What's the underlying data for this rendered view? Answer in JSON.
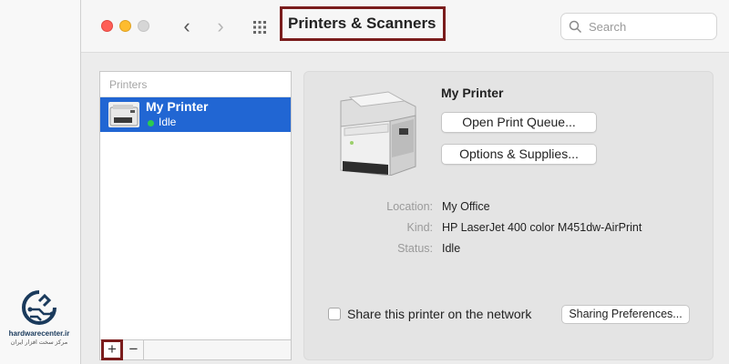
{
  "window": {
    "title": "Printers & Scanners",
    "nav_back_glyph": "‹",
    "nav_forward_glyph": "›"
  },
  "search": {
    "placeholder": "Search",
    "value": ""
  },
  "printers_list": {
    "header": "Printers",
    "items": [
      {
        "name": "My Printer",
        "status": "Idle",
        "status_color": "#2ccc4f",
        "selected": true
      }
    ],
    "add_label": "+",
    "remove_label": "−"
  },
  "detail": {
    "name": "My Printer",
    "open_queue_label": "Open Print Queue...",
    "options_label": "Options & Supplies...",
    "location_label": "Location:",
    "location_value": "My Office",
    "kind_label": "Kind:",
    "kind_value": "HP LaserJet 400 color M451dw-AirPrint",
    "status_label": "Status:",
    "status_value": "Idle",
    "share_label": "Share this printer on the network",
    "share_checked": false,
    "sharing_prefs_label": "Sharing Preferences..."
  },
  "watermark": {
    "site": "hardwarecenter.ir",
    "tagline": "مرکز سخت افزار ایران"
  },
  "colors": {
    "selection": "#2166d3",
    "highlight_border": "#7a1c1c",
    "close": "#fe5f57",
    "minimize": "#febc2e"
  }
}
